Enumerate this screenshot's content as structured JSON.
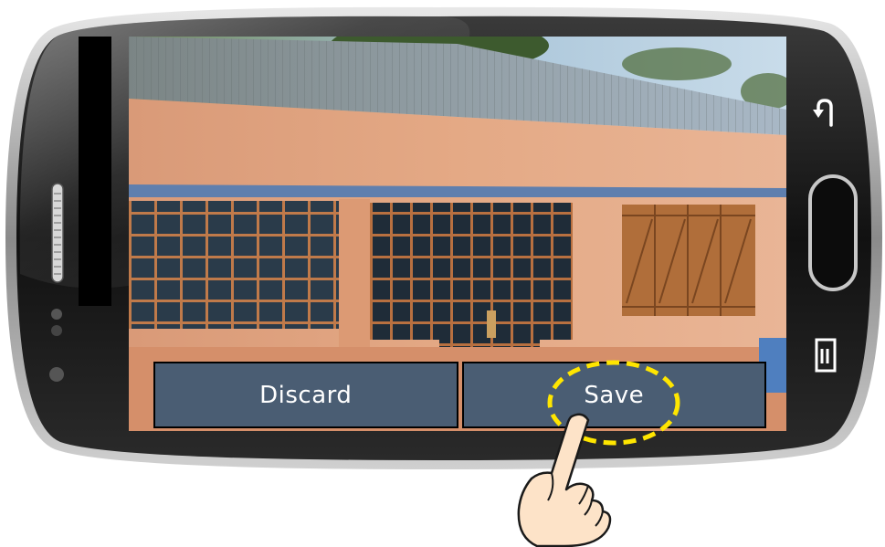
{
  "screen": {
    "image_icon": "photo-preview-building-icon"
  },
  "actions": {
    "discard_label": "Discard",
    "save_label": "Save"
  },
  "device": {
    "back_icon": "back-arrow-icon",
    "home_icon": "home-button-icon",
    "menu_icon": "menu-icon",
    "speaker_icon": "speaker-grille-icon"
  },
  "colors": {
    "action_bar": "#4a5d73",
    "highlight": "#ffe600",
    "phone_body": "#1a1a1a"
  }
}
